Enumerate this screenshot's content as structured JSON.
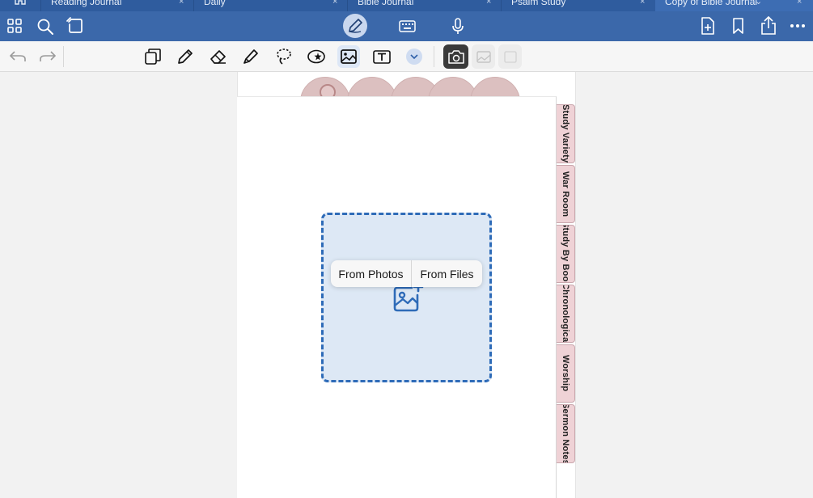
{
  "tabs": [
    {
      "label": "Reading Journal",
      "close": "×"
    },
    {
      "label": "Daily",
      "close": "×"
    },
    {
      "label": "Bible Journal",
      "close": "×"
    },
    {
      "label": "Psalm Study",
      "close": "×"
    },
    {
      "label": "Copy of Bible Journal",
      "close": "×",
      "chevron": "⌄"
    }
  ],
  "toolbar": {
    "left": [
      "grid-icon",
      "search-icon",
      "lasso-page-icon"
    ],
    "center": [
      "pen-mode-icon",
      "keyboard-icon",
      "microphone-icon"
    ],
    "right": [
      "add-page-icon",
      "bookmark-icon",
      "share-icon",
      "more-icon"
    ]
  },
  "subbar": {
    "tools": [
      "undo-icon",
      "redo-icon",
      "shapes-icon",
      "pen-icon",
      "eraser-icon",
      "highlighter-icon",
      "lasso-icon",
      "sticker-icon",
      "image-icon",
      "text-box-icon",
      "chevron-down-icon",
      "camera-icon",
      "photo-ghost-icon",
      "frame-ghost-icon"
    ]
  },
  "side_tabs": [
    "Study Variety",
    "War Room",
    "Study By Book",
    "Chronological",
    "Worship",
    "Sermon Notes"
  ],
  "popup": {
    "from_photos": "From Photos",
    "from_files": "From Files"
  },
  "colors": {
    "tabbar": "#2f5c9e",
    "toolbar": "#3b68aa",
    "accent": "#2e6bb8",
    "tab_pink": "#efd2d6"
  }
}
